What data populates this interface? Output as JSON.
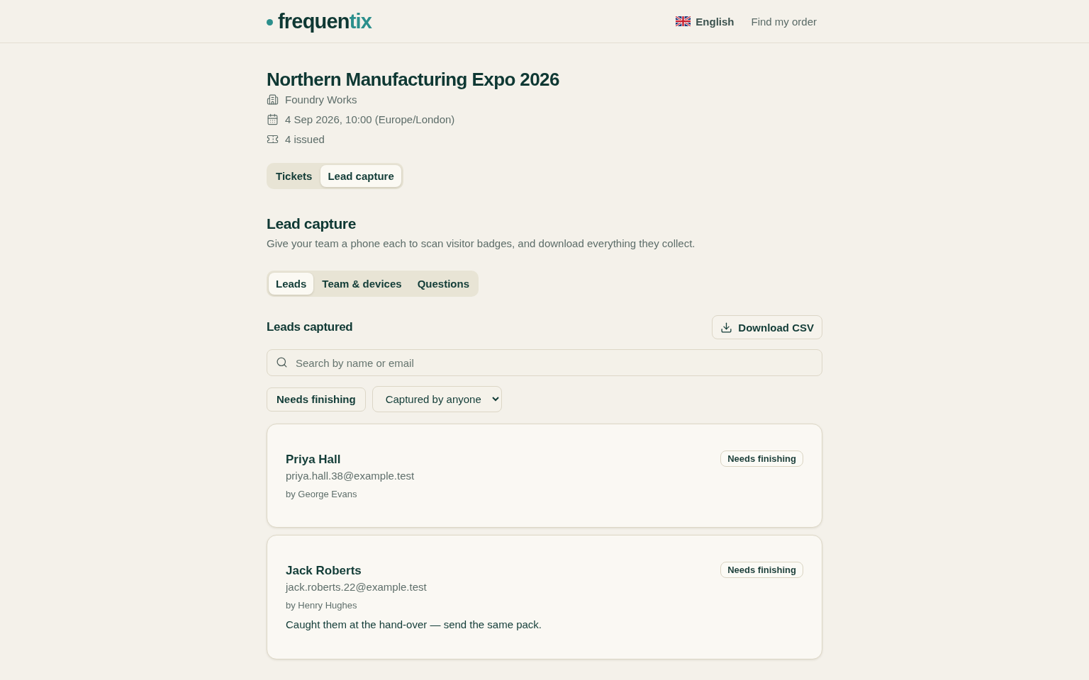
{
  "header": {
    "logo": {
      "parts": [
        {
          "text": "frequen",
          "kind": "dark"
        },
        {
          "text": "tix",
          "kind": "accent"
        }
      ]
    },
    "nav": [
      {
        "kind": "language",
        "label": "English"
      },
      {
        "kind": "link",
        "label": "Find my order"
      }
    ]
  },
  "event": {
    "title": "Northern Manufacturing Expo 2026",
    "details": [
      {
        "kind": "venue",
        "text": "Foundry Works"
      },
      {
        "kind": "date",
        "text": "4 Sep 2026, 10:00 (Europe/London)"
      },
      {
        "kind": "tickets",
        "text": "4 issued"
      }
    ]
  },
  "tabs": [
    {
      "label": "Tickets",
      "selected": false
    },
    {
      "label": "Lead capture",
      "selected": true
    }
  ],
  "section": {
    "title": "Lead capture",
    "description": "Give your team a phone each to scan visitor badges, and download everything they collect.",
    "tabs": [
      {
        "label": "Leads",
        "selected": true
      },
      {
        "label": "Team & devices",
        "selected": false
      },
      {
        "label": "Questions",
        "selected": false
      }
    ]
  },
  "leads": {
    "title": "Leads captured",
    "download_button": "Download CSV",
    "search": {
      "placeholder": "Search by name or email"
    },
    "filters": {
      "toggle": "Needs finishing",
      "captured_by": "Captured by anyone"
    },
    "items": [
      {
        "name": "Priya Hall",
        "email": "priya.hall.38@example.test",
        "captured_by": "by George Evans",
        "status": "Needs finishing"
      },
      {
        "name": "Jack Roberts",
        "email": "jack.roberts.22@example.test",
        "captured_by": "by Henry Hughes",
        "status": "Needs finishing",
        "note": "Caught them at the hand-over — send the same pack."
      }
    ]
  }
}
